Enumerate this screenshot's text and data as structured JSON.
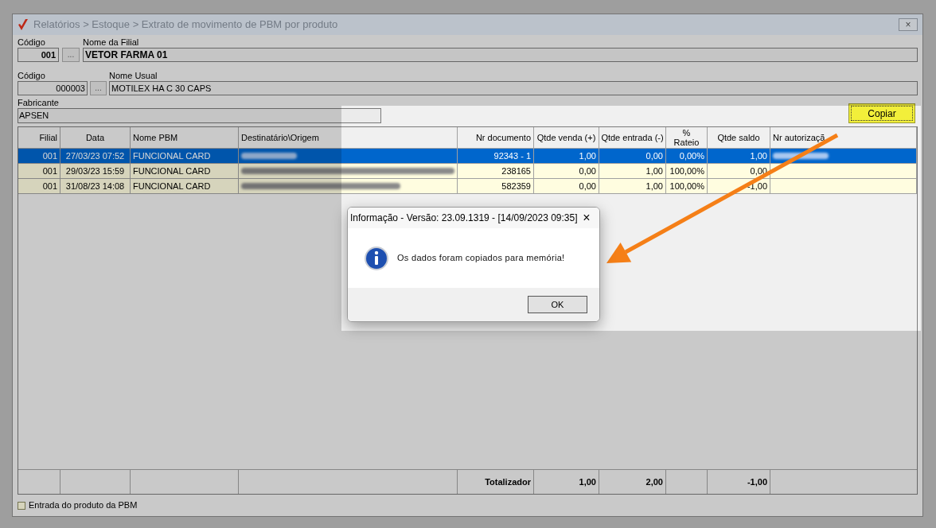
{
  "window": {
    "title": "Relatórios > Estoque > Extrato de movimento de PBM por produto",
    "close": "×"
  },
  "branch": {
    "code_label": "Código",
    "code": "001",
    "lookup": "...",
    "name_label": "Nome da Filial",
    "name": "VETOR FARMA 01"
  },
  "product": {
    "code_label": "Código",
    "code": "000003",
    "lookup": "...",
    "name_label": "Nome Usual",
    "name": "MOTILEX HA C 30 CAPS"
  },
  "manufacturer": {
    "label": "Fabricante",
    "value": "APSEN"
  },
  "copy_button": "Copiar",
  "table": {
    "columns": [
      "Filial",
      "Data",
      "Nome PBM",
      "Destinatário\\Origem",
      "Nr documento",
      "Qtde venda (+)",
      "Qtde entrada (-)",
      "% Rateio",
      "Qtde saldo",
      "Nr autorizaçã"
    ],
    "rows": [
      {
        "selected": true,
        "recipient_redacted": true,
        "authorization_redacted": true,
        "cells": [
          "001",
          "27/03/23 07:52",
          "FUNCIONAL CARD",
          "",
          "92343 - 1",
          "1,00",
          "0,00",
          "0,00%",
          "1,00",
          ""
        ]
      },
      {
        "selected": false,
        "recipient_redacted": true,
        "authorization_redacted": false,
        "cells": [
          "001",
          "29/03/23 15:59",
          "FUNCIONAL CARD",
          "",
          "238165",
          "0,00",
          "1,00",
          "100,00%",
          "0,00",
          ""
        ]
      },
      {
        "selected": false,
        "recipient_redacted": true,
        "authorization_redacted": false,
        "cells": [
          "001",
          "31/08/23 14:08",
          "FUNCIONAL CARD",
          "",
          "582359",
          "0,00",
          "1,00",
          "100,00%",
          "-1,00",
          ""
        ]
      }
    ],
    "totals": {
      "label": "Totalizador",
      "sold": "1,00",
      "entered": "2,00",
      "balance": "-1,00"
    }
  },
  "legend": {
    "label": "Entrada do produto da PBM"
  },
  "dialog": {
    "title": "Informação - Versão: 23.09.1319 - [14/09/2023 09:35]",
    "close": "×",
    "message": "Os dados foram copiados para memória!",
    "ok_button": "OK"
  }
}
